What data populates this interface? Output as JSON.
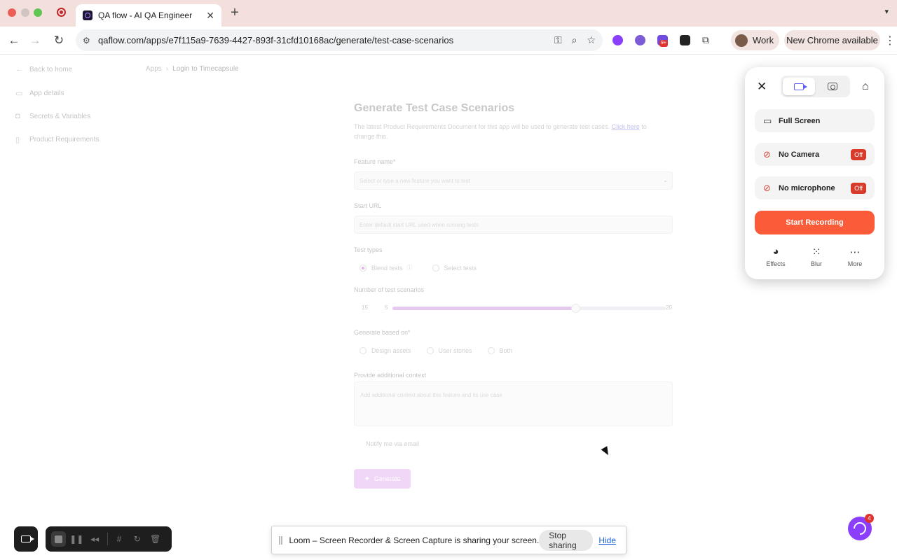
{
  "browser": {
    "tab_title": "QA flow - AI QA Engineer",
    "url": "qaflow.com/apps/e7f115a9-7639-4427-893f-31cfd10168ac/generate/test-case-scenarios",
    "profile_label": "Work",
    "update_label": "New Chrome available",
    "extension_badge": "9+"
  },
  "sidebar": {
    "items": [
      {
        "label": "Back to home",
        "icon": "arrow-left-icon"
      },
      {
        "label": "App details",
        "icon": "app-icon"
      },
      {
        "label": "Secrets & Variables",
        "icon": "lock-icon"
      },
      {
        "label": "Product Requirements",
        "icon": "document-icon"
      }
    ]
  },
  "breadcrumb": {
    "root": "Apps",
    "current": "Login to Timecapsule"
  },
  "form": {
    "title": "Generate Test Case Scenarios",
    "description": "The latest Product Requirements Document for this app will be used to generate test cases.",
    "description_link": "Click here",
    "description_suffix": "to change this.",
    "feature_label": "Feature name*",
    "feature_placeholder": "Select or type a new feature you want to test",
    "start_url_label": "Start URL",
    "start_url_placeholder": "Enter default start URL used when running tests",
    "test_types_label": "Test types",
    "test_types": [
      {
        "label": "Blend tests",
        "selected": true
      },
      {
        "label": "Select tests",
        "selected": false
      }
    ],
    "scenarios_label": "Number of test scenarios",
    "scenarios_value": "15",
    "scenarios_min": "5",
    "scenarios_max": "20",
    "scenarios_fraction": 0.67,
    "based_on_label": "Generate based on*",
    "based_on_options": [
      {
        "label": "Design assets"
      },
      {
        "label": "User stories"
      },
      {
        "label": "Both"
      }
    ],
    "context_label": "Provide additional context",
    "context_placeholder": "Add additional context about this feature and its use case",
    "notify_label": "Notify me via email",
    "generate_label": "Generate"
  },
  "loom": {
    "options": [
      {
        "label": "Full Screen",
        "icon": "monitor-icon",
        "status": ""
      },
      {
        "label": "No Camera",
        "icon": "camera-off-icon",
        "status": "Off"
      },
      {
        "label": "No microphone",
        "icon": "mic-off-icon",
        "status": "Off"
      }
    ],
    "start_label": "Start Recording",
    "tools": [
      {
        "label": "Effects",
        "icon": "effects-icon"
      },
      {
        "label": "Blur",
        "icon": "blur-icon"
      },
      {
        "label": "More",
        "icon": "more-icon"
      }
    ]
  },
  "share_bar": {
    "text": "Loom – Screen Recorder & Screen Capture is sharing your screen.",
    "stop_label": "Stop sharing",
    "hide_label": "Hide"
  },
  "help": {
    "badge": "4"
  },
  "colors": {
    "loom_accent": "#625df5",
    "record_button": "#fb5b38",
    "off_badge": "#d93b2b",
    "generate_button": "#f1d7f7"
  }
}
